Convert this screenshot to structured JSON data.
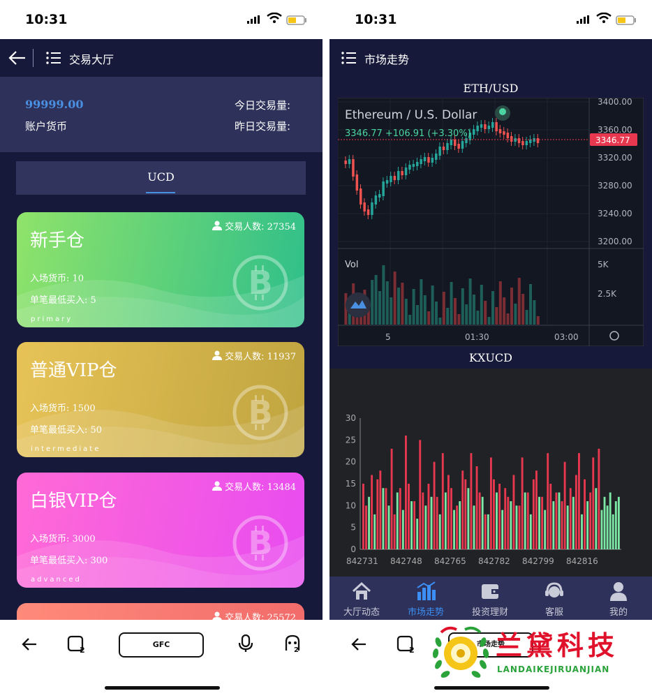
{
  "left": {
    "status": {
      "time": "10:31"
    },
    "nav": {
      "title": "交易大厅"
    },
    "account": {
      "balance": "99999.00",
      "balance_label": "账户货币",
      "today_volume": "今日交易量:",
      "yesterday_volume": "昨日交易量:"
    },
    "tab": {
      "label": "UCD"
    },
    "cards": [
      {
        "title": "新手仓",
        "traders_label": "交易人数:",
        "traders": "27354",
        "entry": "入场货币: 10",
        "min_buy": "单笔最低买入: 5",
        "tier": "primary",
        "colors": [
          "#8fe36a",
          "#2fbf8a"
        ]
      },
      {
        "title": "普通VIP仓",
        "traders_label": "交易人数:",
        "traders": "11937",
        "entry": "入场货币: 1500",
        "min_buy": "单笔最低买入: 50",
        "tier": "intermediate",
        "colors": [
          "#e7c357",
          "#bfa43f"
        ]
      },
      {
        "title": "白银VIP仓",
        "traders_label": "交易人数:",
        "traders": "13484",
        "entry": "入场货币: 3000",
        "min_buy": "单笔最低买入: 300",
        "tier": "advanced",
        "colors": [
          "#ff6ad6",
          "#e84cf0"
        ]
      },
      {
        "title": "",
        "traders_label": "交易人数:",
        "traders": "25572",
        "colors": [
          "#ff8a7a",
          "#f06a6a"
        ]
      }
    ],
    "bottom": {
      "center_label": "GFC"
    }
  },
  "right": {
    "status": {
      "time": "10:31"
    },
    "nav": {
      "title": "市场走势"
    },
    "eth": {
      "title": "ETH/USD",
      "pair_name": "Ethereum / U.S. Dollar",
      "quote": "3346.77 +106.91 (+3.30%)",
      "price_tag": "3346.77",
      "y_ticks": [
        "3400.00",
        "3360.00",
        "3320.00",
        "3280.00",
        "3240.00",
        "3200.00"
      ],
      "vol_label": "Vol",
      "vol_ticks": [
        "5K",
        "2.5K"
      ],
      "x_ticks": [
        "5",
        "01:30",
        "03:00"
      ]
    },
    "kx": {
      "title": "KXUCD"
    },
    "tabs": [
      {
        "label": "大厅动态",
        "icon": "home-icon"
      },
      {
        "label": "市场走势",
        "icon": "bar-chart-icon"
      },
      {
        "label": "投资理财",
        "icon": "wallet-icon"
      },
      {
        "label": "客服",
        "icon": "headset-icon"
      },
      {
        "label": "我的",
        "icon": "user-icon"
      }
    ],
    "bottom": {
      "center_label": "市场走势"
    }
  },
  "watermark": {
    "brand": "兰黛科技",
    "sub": "LANDAIKEJIRUANJIAN"
  },
  "chart_data": [
    {
      "type": "bar",
      "title": "KXUCD",
      "ylim": [
        0,
        30
      ],
      "y_ticks": [
        0,
        5,
        10,
        15,
        20,
        25,
        30
      ],
      "x_tick_labels": [
        "842731",
        "842748",
        "842765",
        "842782",
        "842799",
        "842816"
      ],
      "series": [
        {
          "name": "red",
          "color": "#e8384f",
          "values": [
            15,
            10,
            17,
            16,
            18,
            14,
            23,
            8,
            14,
            26,
            15,
            11,
            25,
            13,
            15,
            20,
            12,
            22,
            17,
            14,
            10,
            18,
            16,
            22,
            19,
            13,
            8,
            21,
            16,
            15,
            14,
            12,
            17,
            10,
            21,
            13,
            16,
            18,
            12,
            22,
            15,
            13,
            11,
            20,
            14,
            17,
            22,
            16,
            13,
            21,
            23
          ]
        },
        {
          "name": "green",
          "color": "#7de8a6",
          "values": [
            12,
            8,
            14,
            10,
            13,
            9,
            11,
            7,
            10,
            12,
            8,
            13,
            9,
            11,
            14,
            10,
            12,
            8,
            13,
            9,
            11,
            10,
            13,
            8,
            12,
            9,
            11,
            13,
            10,
            12,
            8,
            11,
            14,
            9,
            12,
            10,
            13,
            8,
            11,
            12
          ]
        }
      ]
    }
  ]
}
